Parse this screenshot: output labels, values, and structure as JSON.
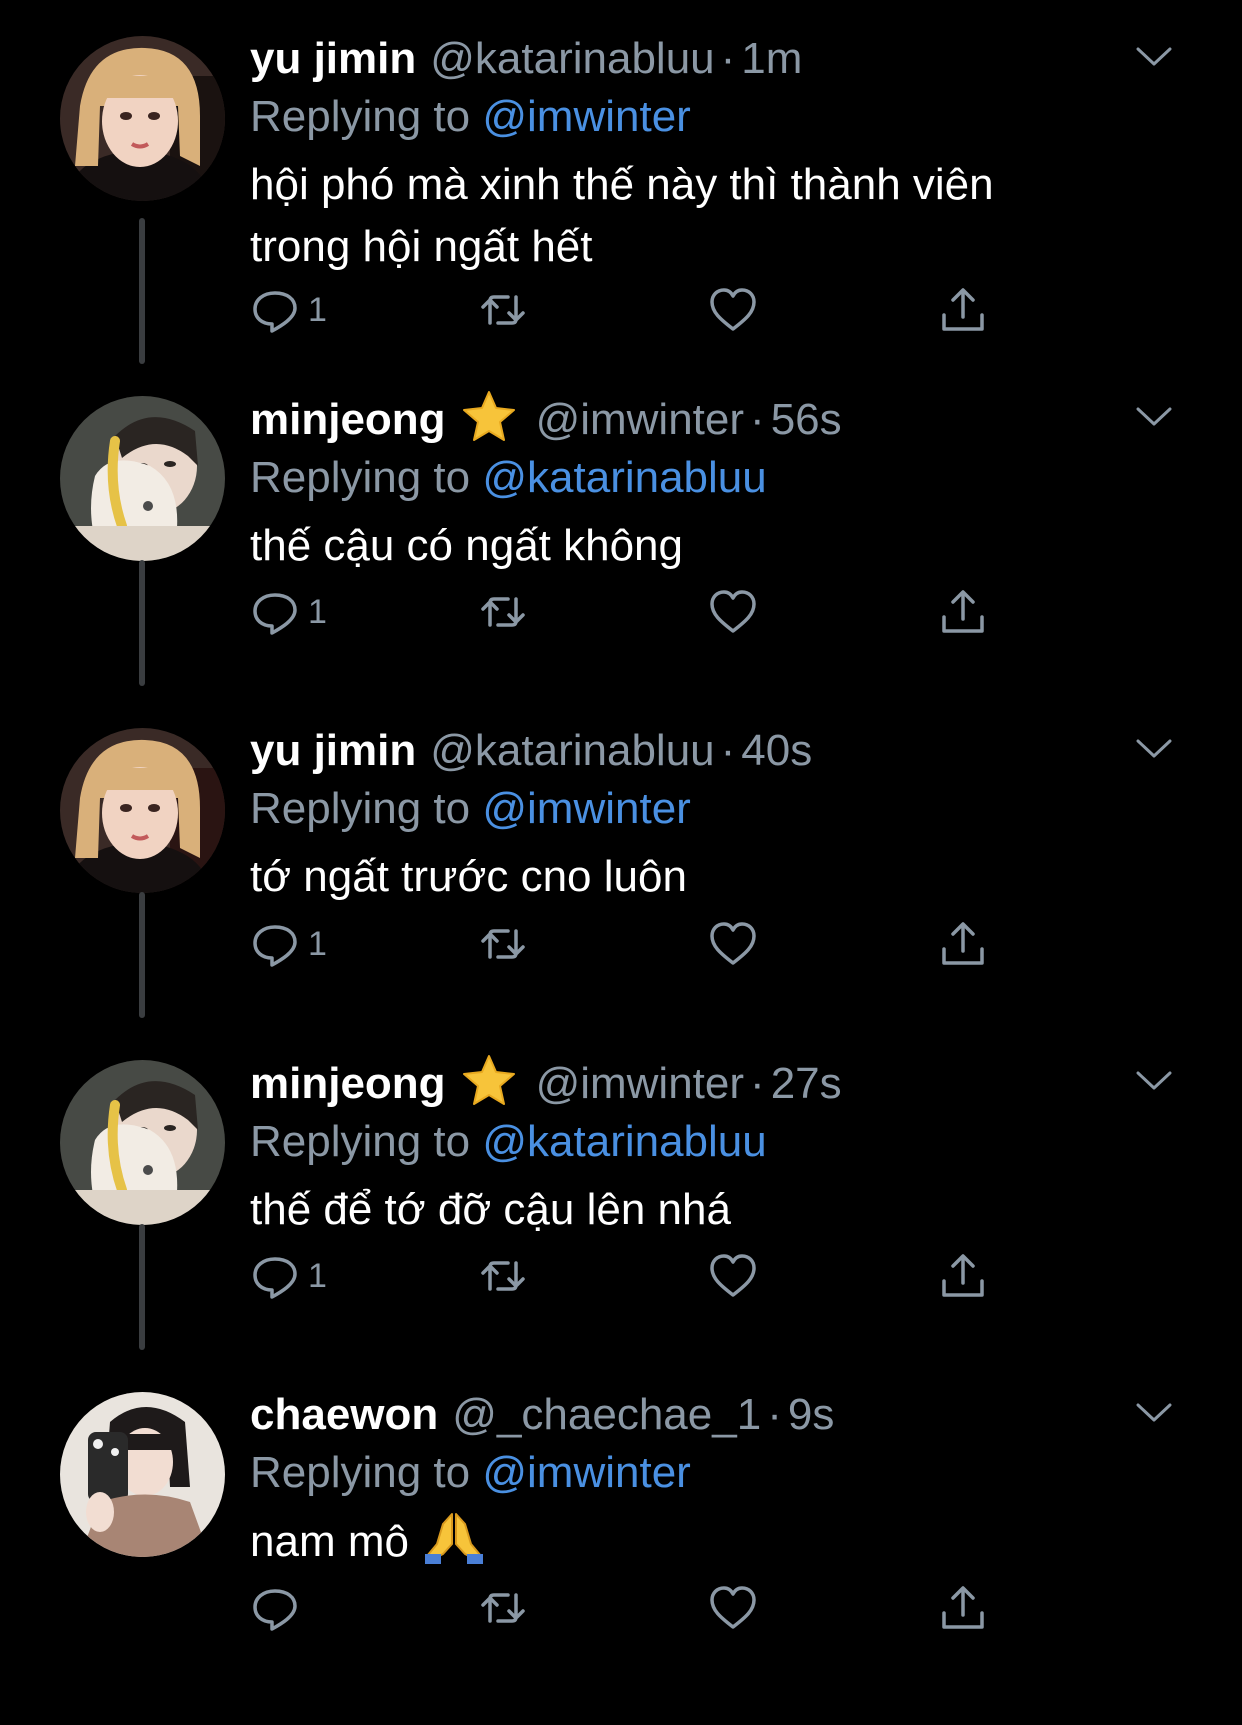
{
  "tweets": [
    {
      "name": "yu jimin",
      "handle": "@katarinabluu",
      "dot": "·",
      "time": "1m",
      "replying_prefix": "Replying to ",
      "replying_handle": "@imwinter",
      "text_lines": [
        "hội phó mà xinh thế này thì thành viên",
        "trong hội ngất hết"
      ],
      "reply_count": "1",
      "avatar": "yu-jimin-avatar"
    },
    {
      "name": "minjeong",
      "badge": "star-emoji",
      "handle": "@imwinter",
      "dot": "·",
      "time": "56s",
      "replying_prefix": "Replying to ",
      "replying_handle": "@katarinabluu",
      "text_lines": [
        "thế cậu có ngất không"
      ],
      "reply_count": "1",
      "avatar": "minjeong-avatar"
    },
    {
      "name": "yu jimin",
      "handle": "@katarinabluu",
      "dot": "·",
      "time": "40s",
      "replying_prefix": "Replying to ",
      "replying_handle": "@imwinter",
      "text_lines": [
        "tớ ngất trước cno luôn"
      ],
      "reply_count": "1",
      "avatar": "yu-jimin-avatar"
    },
    {
      "name": "minjeong",
      "badge": "star-emoji",
      "handle": "@imwinter",
      "dot": "·",
      "time": "27s",
      "replying_prefix": "Replying to ",
      "replying_handle": "@katarinabluu",
      "text_lines": [
        "thế để tớ đỡ cậu lên nhá"
      ],
      "reply_count": "1",
      "avatar": "minjeong-avatar"
    },
    {
      "name": "chaewon",
      "handle": "@_chaechae_1",
      "dot": "·",
      "time": "9s",
      "replying_prefix": "Replying to ",
      "replying_handle": "@imwinter",
      "text_lines": [
        "nam mô"
      ],
      "emoji": "folded-hands-emoji",
      "reply_count": "",
      "avatar": "chaewon-avatar"
    }
  ],
  "colors": {
    "background": "#000000",
    "text": "#ffffff",
    "muted": "#8b98a5",
    "mention": "#4a90e2",
    "thread_line": "#3a3d40"
  },
  "icons": {
    "reply": "reply-icon",
    "retweet": "retweet-icon",
    "like": "heart-icon",
    "share": "share-icon",
    "more": "chevron-down-icon"
  }
}
